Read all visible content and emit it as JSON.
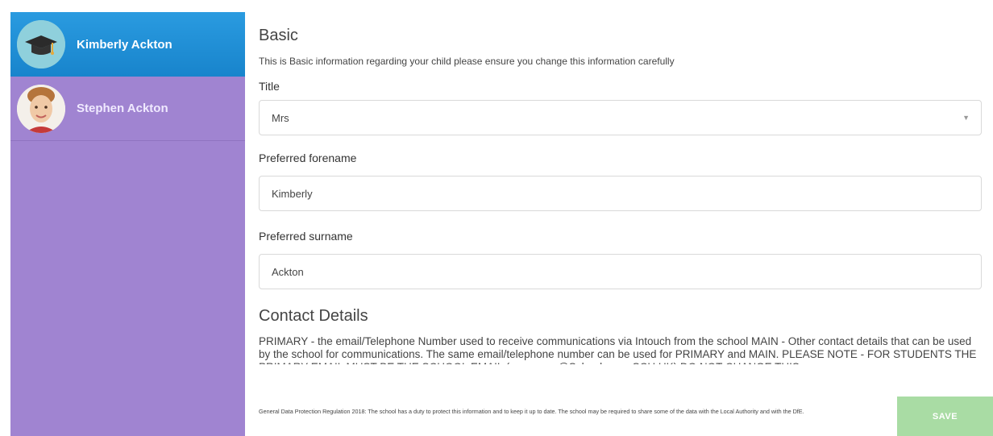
{
  "sidebar": {
    "items": [
      {
        "name": "Kimberly Ackton",
        "active": true,
        "icon": "graduation-cap-icon"
      },
      {
        "name": "Stephen Ackton",
        "active": false,
        "icon": "child-photo"
      }
    ]
  },
  "basic": {
    "title": "Basic",
    "description": "This is Basic information regarding your child please ensure you change this information carefully",
    "title_label": "Title",
    "title_value": "Mrs",
    "forename_label": "Preferred forename",
    "forename_value": "Kimberly",
    "surname_label": "Preferred surname",
    "surname_value": "Ackton"
  },
  "contact": {
    "title": "Contact Details",
    "text": "PRIMARY - the email/Telephone Number used to receive communications via Intouch from the school MAIN - Other contact details that can be used by the school for communications. The same email/telephone number can be used for PRIMARY and MAIN. PLEASE NOTE - FOR STUDENTS THE PRIMARY EMAIL MUST BE THE SCHOOL EMAIL (username@Schoolname.SCH.UK) DO NOT CHANGE THIS"
  },
  "footer": {
    "gdpr_text": "General Data Protection Regulation 2018: The school has a duty to protect this information and to keep it up to date. The school may be required to share some of the data with the Local Authority and with the DfE.",
    "save_label": "SAVE"
  },
  "colors": {
    "sidebar_bg": "#a084d1",
    "active_item": "#1e8fd6",
    "save_button": "#a9dca4"
  }
}
